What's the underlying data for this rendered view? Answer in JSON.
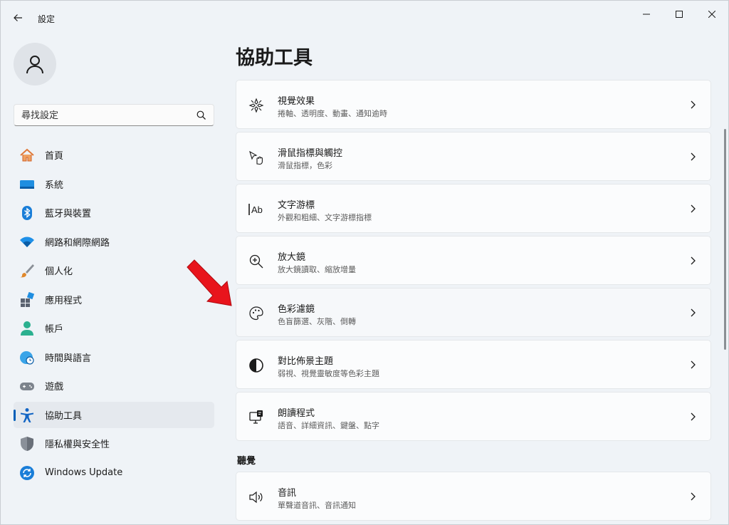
{
  "app": {
    "title": "設定"
  },
  "search": {
    "placeholder": "尋找設定"
  },
  "sidebar": {
    "items": [
      {
        "label": "首頁",
        "icon": "home-icon"
      },
      {
        "label": "系統",
        "icon": "monitor-icon"
      },
      {
        "label": "藍牙與裝置",
        "icon": "bluetooth-icon"
      },
      {
        "label": "網路和網際網路",
        "icon": "wifi-icon"
      },
      {
        "label": "個人化",
        "icon": "brush-icon"
      },
      {
        "label": "應用程式",
        "icon": "apps-icon"
      },
      {
        "label": "帳戶",
        "icon": "person-icon"
      },
      {
        "label": "時間與語言",
        "icon": "globe-clock-icon"
      },
      {
        "label": "遊戲",
        "icon": "gamepad-icon"
      },
      {
        "label": "協助工具",
        "icon": "accessibility-icon",
        "selected": true
      },
      {
        "label": "隱私權與安全性",
        "icon": "shield-icon"
      },
      {
        "label": "Windows Update",
        "icon": "update-icon"
      }
    ]
  },
  "main": {
    "title": "協助工具",
    "cards": [
      {
        "title": "視覺效果",
        "subtitle": "捲軸、透明度、動畫、通知逾時",
        "icon": "visual-effects-icon"
      },
      {
        "title": "滑鼠指標與觸控",
        "subtitle": "滑鼠指標，色彩",
        "icon": "mouse-pointer-icon"
      },
      {
        "title": "文字游標",
        "subtitle": "外觀和粗細、文字游標指標",
        "icon": "text-cursor-icon"
      },
      {
        "title": "放大鏡",
        "subtitle": "放大鏡讀取、縮放增量",
        "icon": "magnifier-icon"
      },
      {
        "title": "色彩濾鏡",
        "subtitle": "色盲篩選、灰階、倒轉",
        "icon": "palette-icon"
      },
      {
        "title": "對比佈景主題",
        "subtitle": "弱視、視覺靈敏度等色彩主題",
        "icon": "contrast-icon"
      },
      {
        "title": "朗讀程式",
        "subtitle": "語音、詳細資訊、鍵盤、點字",
        "icon": "narrator-icon"
      }
    ],
    "section_heading": "聽覺",
    "audio_card": {
      "title": "音訊",
      "subtitle": "單聲道音訊、音訊通知",
      "icon": "speaker-icon"
    }
  },
  "colors": {
    "accent": "#005fb8",
    "annotation_arrow": "#e8141c"
  }
}
